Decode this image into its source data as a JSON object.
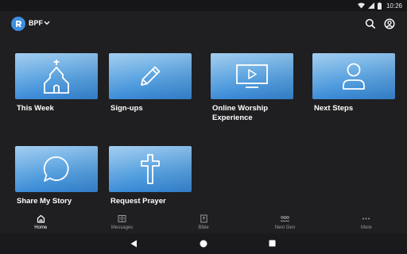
{
  "status_bar": {
    "time": "10:26"
  },
  "app_bar": {
    "app_name": "BPF",
    "icons": {
      "logo": "bpf-logo-icon",
      "dropdown": "chevron-down-icon",
      "search": "search-icon",
      "account": "account-circle-icon"
    }
  },
  "tiles": [
    {
      "label": "This Week",
      "icon": "church-icon"
    },
    {
      "label": "Sign-ups",
      "icon": "pencil-icon"
    },
    {
      "label": "Online Worship Experience",
      "icon": "video-monitor-icon"
    },
    {
      "label": "Next Steps",
      "icon": "person-icon"
    },
    {
      "label": "Share My Story",
      "icon": "chat-bubble-icon"
    },
    {
      "label": "Request Prayer",
      "icon": "cross-icon"
    }
  ],
  "bottom_nav": [
    {
      "label": "Home",
      "icon": "home-icon",
      "active": true
    },
    {
      "label": "Messages",
      "icon": "messages-icon",
      "active": false
    },
    {
      "label": "Bible",
      "icon": "bible-icon",
      "active": false
    },
    {
      "label": "Next Gen",
      "icon": "group-icon",
      "active": false
    },
    {
      "label": "More",
      "icon": "more-dots-icon",
      "active": false
    }
  ],
  "colors": {
    "background": "#1f1f21",
    "tile_blue": "#5aa3e0",
    "accent": "#3d8fe0",
    "nav_inactive": "#9a9a9e"
  }
}
